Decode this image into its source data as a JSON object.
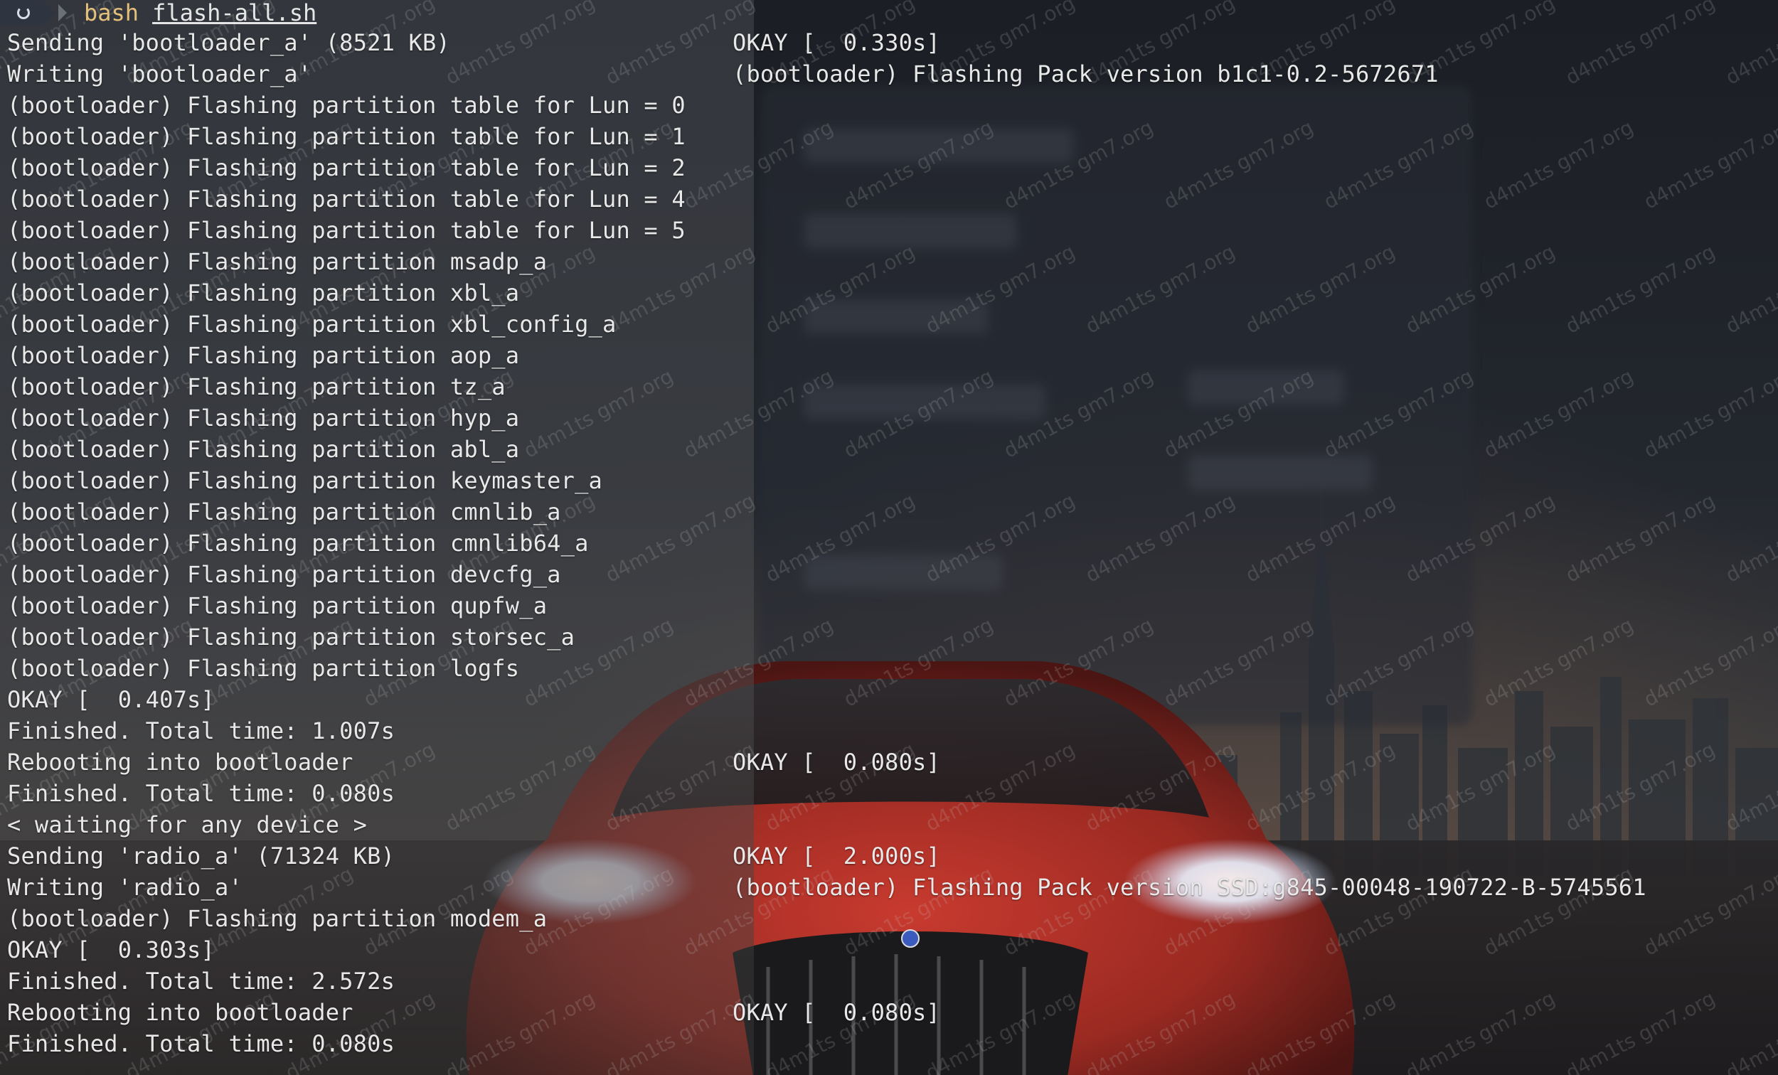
{
  "prompt": {
    "command": "bash",
    "argument": "flash-all.sh"
  },
  "left_lines": [
    "Sending 'bootloader_a' (8521 KB)",
    "Writing 'bootloader_a'",
    "(bootloader) Flashing partition table for Lun = 0",
    "(bootloader) Flashing partition table for Lun = 1",
    "(bootloader) Flashing partition table for Lun = 2",
    "(bootloader) Flashing partition table for Lun = 4",
    "(bootloader) Flashing partition table for Lun = 5",
    "(bootloader) Flashing partition msadp_a",
    "(bootloader) Flashing partition xbl_a",
    "(bootloader) Flashing partition xbl_config_a",
    "(bootloader) Flashing partition aop_a",
    "(bootloader) Flashing partition tz_a",
    "(bootloader) Flashing partition hyp_a",
    "(bootloader) Flashing partition abl_a",
    "(bootloader) Flashing partition keymaster_a",
    "(bootloader) Flashing partition cmnlib_a",
    "(bootloader) Flashing partition cmnlib64_a",
    "(bootloader) Flashing partition devcfg_a",
    "(bootloader) Flashing partition qupfw_a",
    "(bootloader) Flashing partition storsec_a",
    "(bootloader) Flashing partition logfs",
    "OKAY [  0.407s]",
    "Finished. Total time: 1.007s",
    "Rebooting into bootloader",
    "Finished. Total time: 0.080s",
    "< waiting for any device >",
    "Sending 'radio_a' (71324 KB)",
    "Writing 'radio_a'",
    "(bootloader) Flashing partition modem_a",
    "OKAY [  0.303s]",
    "Finished. Total time: 2.572s",
    "Rebooting into bootloader",
    "Finished. Total time: 0.080s"
  ],
  "right_lines": {
    "r0": "OKAY [  0.330s]",
    "r1": "(bootloader) Flashing Pack version b1c1-0.2-5672671",
    "r23": "OKAY [  0.080s]",
    "r26": "OKAY [  2.000s]",
    "r27": "(bootloader) Flashing Pack version SSD:g845-00048-190722-B-5745561",
    "r31": "OKAY [  0.080s]"
  },
  "watermark": "d4m1ts gm7.org",
  "colors": {
    "prompt_command": "#e5c07b",
    "terminal_text": "#e8e8e8",
    "car_body": "#b8322a"
  }
}
